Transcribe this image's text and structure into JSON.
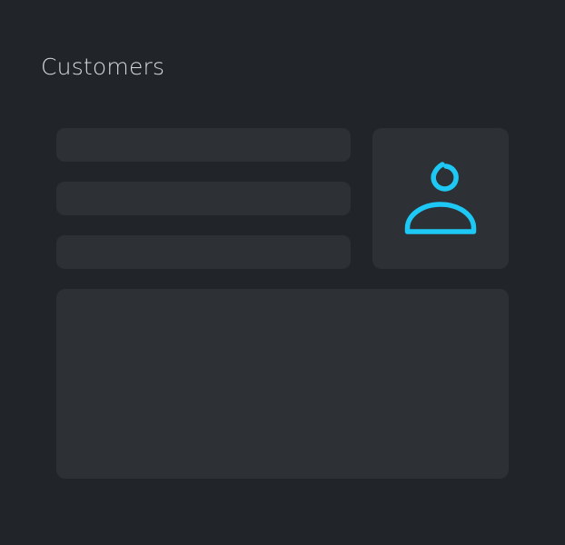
{
  "header": {
    "title": "Customers"
  },
  "icons": {
    "avatar": "user-avatar-icon"
  },
  "colors": {
    "background": "#212428",
    "panel": "#2d3035",
    "text": "#d7d9dc",
    "accent": "#1ec8f5"
  }
}
